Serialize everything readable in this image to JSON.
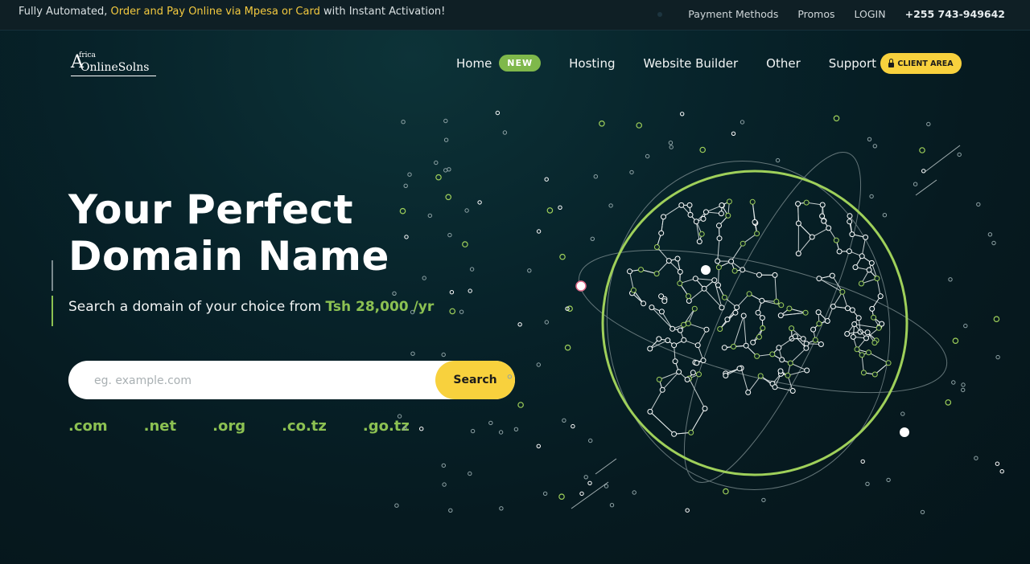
{
  "topbar": {
    "promo_prefix": "Fully Automated, ",
    "promo_highlight": "Order and Pay Online via Mpesa or Card",
    "promo_suffix": " with Instant Activation!",
    "links": [
      "Payment Methods",
      "Promos",
      "LOGIN"
    ],
    "phone": "+255 743-949642"
  },
  "logo": {
    "top": "frica",
    "initial": "A",
    "rest": "OnlineSolns"
  },
  "nav": {
    "items": [
      "Home",
      "Hosting",
      "Website Builder",
      "Other",
      "Support"
    ],
    "home_badge": "NEW",
    "client_area": "CLIENT AREA"
  },
  "hero": {
    "title_line1": "Your Perfect",
    "title_line2": "Domain Name",
    "subtitle": "Search a domain of your choice from ",
    "price": "Tsh 28,000 /yr"
  },
  "search": {
    "placeholder": "eg. example.com",
    "button": "Search"
  },
  "tlds": [
    ".com",
    ".net",
    ".org",
    ".co.tz",
    ".go.tz"
  ],
  "colors": {
    "accent_green": "#8cc152",
    "accent_yellow": "#f8d13d",
    "background": "#061a20"
  },
  "icons": [
    "lock-icon",
    "globe-network-illustration"
  ]
}
